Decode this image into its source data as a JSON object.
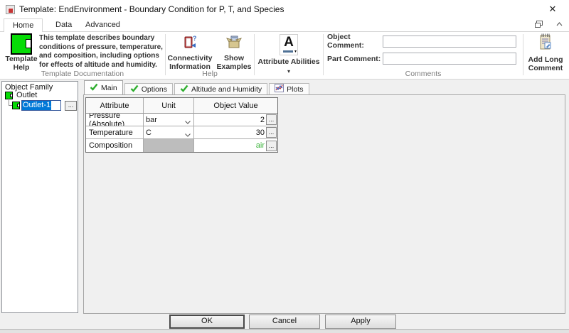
{
  "window": {
    "title": "Template: EndEnvironment - Boundary Condition for P, T, and Species"
  },
  "ribbon": {
    "tabs": {
      "home": "Home",
      "data": "Data",
      "advanced": "Advanced"
    },
    "template_documentation": {
      "help_button_label": "Template Help",
      "description": "This template describes boundary conditions of pressure, temperature, and composition, including options for effects of altitude and humidity.",
      "group_label": "Template Documentation"
    },
    "help_group": {
      "connectivity_label": "Connectivity Information",
      "show_examples_label": "Show Examples",
      "group_label": "Help"
    },
    "attribute_abilities": {
      "label": "Attribute Abilities"
    },
    "comments_group": {
      "object_comment_label": "Object Comment:",
      "object_comment_value": "",
      "part_comment_label": "Part Comment:",
      "part_comment_value": "",
      "group_label": "Comments"
    },
    "add_long_comment_label": "Add Long Comment"
  },
  "object_family": {
    "caption": "Object Family",
    "root_item": "Outlet",
    "child_item": "Outlet-1"
  },
  "main_tabs": {
    "0": {
      "label": "Main"
    },
    "1": {
      "label": "Options"
    },
    "2": {
      "label": "Altitude and Humidity"
    },
    "3": {
      "label": "Plots"
    }
  },
  "table": {
    "headers": [
      "Attribute",
      "Unit",
      "Object Value"
    ],
    "rows": [
      {
        "attribute": "Pressure (Absolute)",
        "unit": "bar",
        "value": "2"
      },
      {
        "attribute": "Temperature",
        "unit": "C",
        "value": "30"
      },
      {
        "attribute": "Composition",
        "unit": "",
        "value": "air"
      }
    ]
  },
  "footer": {
    "ok": "OK",
    "cancel": "Cancel",
    "apply": "Apply"
  },
  "misc": {
    "ellipsis": "...",
    "close_glyph": "✕",
    "dropdown_glyph": "▾"
  },
  "colors": {
    "component_green": "#06dc06",
    "check_green": "#2eae2e",
    "value_green": "#3cb43c",
    "selection_blue": "#0078d7",
    "app_icon_red": "#c53434"
  }
}
